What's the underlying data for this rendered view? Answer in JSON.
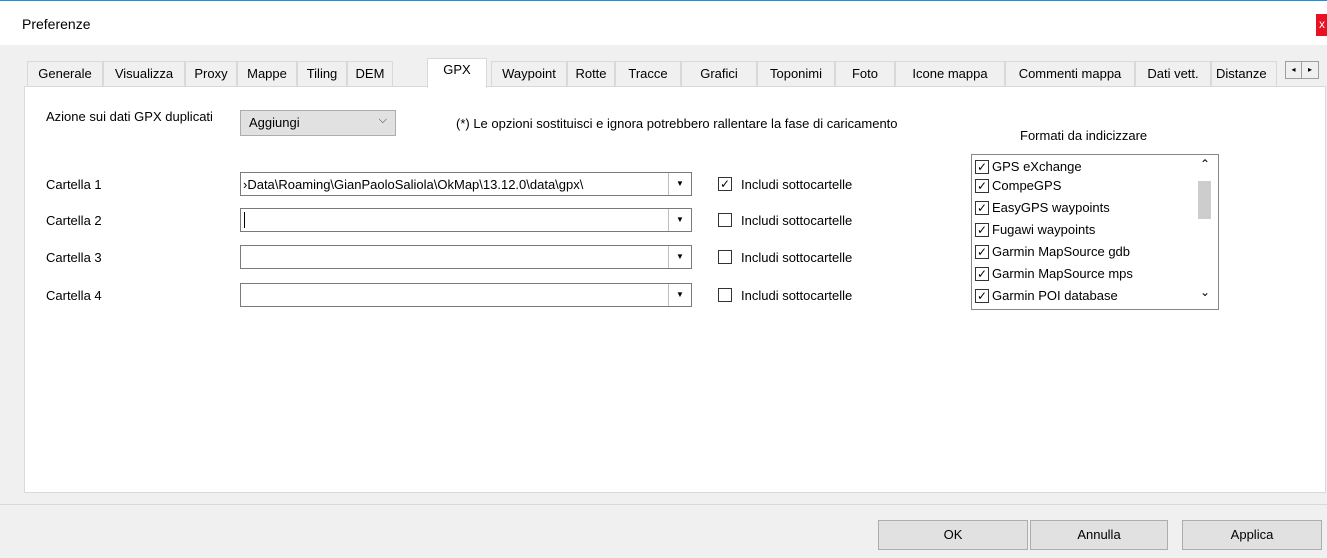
{
  "window": {
    "title": "Preferenze",
    "close_label": "x"
  },
  "tabs": [
    {
      "label": "Generale"
    },
    {
      "label": "Visualizza"
    },
    {
      "label": "Proxy"
    },
    {
      "label": "Mappe"
    },
    {
      "label": "Tiling"
    },
    {
      "label": "DEM"
    },
    {
      "label": "GPX"
    },
    {
      "label": "Waypoint"
    },
    {
      "label": "Rotte"
    },
    {
      "label": "Tracce"
    },
    {
      "label": "Grafici"
    },
    {
      "label": "Toponimi"
    },
    {
      "label": "Foto"
    },
    {
      "label": "Icone mappa"
    },
    {
      "label": "Commenti mappa"
    },
    {
      "label": "Dati vett."
    },
    {
      "label": "Distanze"
    }
  ],
  "active_tab": "GPX",
  "tab_scroll": {
    "left": "◂",
    "right": "▸"
  },
  "gpx": {
    "duplicate_label": "Azione sui dati GPX duplicati",
    "duplicate_value": "Aggiungi",
    "note": "(*) Le opzioni sostituisci e ignora potrebbero rallentare la fase di caricamento",
    "folders": [
      {
        "label": "Cartella 1",
        "value": "›Data\\Roaming\\GianPaoloSaliola\\OkMap\\13.12.0\\data\\gpx\\",
        "include_label": "Includi sottocartelle",
        "include_checked": true
      },
      {
        "label": "Cartella 2",
        "value": "",
        "include_label": "Includi sottocartelle",
        "include_checked": false
      },
      {
        "label": "Cartella 3",
        "value": "",
        "include_label": "Includi sottocartelle",
        "include_checked": false
      },
      {
        "label": "Cartella 4",
        "value": "",
        "include_label": "Includi sottocartelle",
        "include_checked": false
      }
    ],
    "formats_label": "Formati da indicizzare",
    "formats": [
      {
        "label": "GPS eXchange",
        "checked": true
      },
      {
        "label": "CompeGPS",
        "checked": true
      },
      {
        "label": "EasyGPS waypoints",
        "checked": true
      },
      {
        "label": "Fugawi waypoints",
        "checked": true
      },
      {
        "label": "Garmin MapSource gdb",
        "checked": true
      },
      {
        "label": "Garmin MapSource mps",
        "checked": true
      },
      {
        "label": "Garmin POI database",
        "checked": true
      }
    ]
  },
  "buttons": {
    "ok": "OK",
    "cancel": "Annulla",
    "apply": "Applica"
  },
  "glyphs": {
    "check": "✓",
    "dropdown": "▼",
    "chevron": "⌵",
    "scroll_up": "⌃",
    "scroll_down": "⌄"
  }
}
